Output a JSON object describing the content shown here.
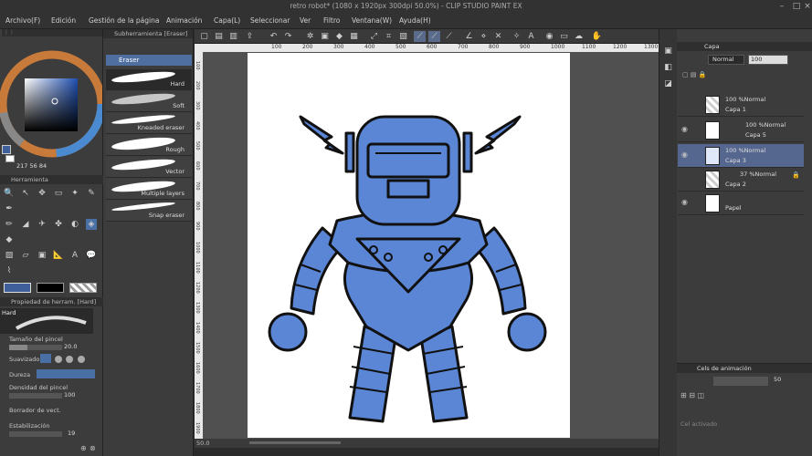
{
  "window": {
    "title": "retro robot* (1080 x 1920px 300dpi 50.0%) - CLIP STUDIO PAINT EX"
  },
  "menu": {
    "items": [
      "Archivo(F)",
      "Edición",
      "Gestión de la página",
      "Animación",
      "Capa(L)",
      "Seleccionar",
      "Ver",
      "Filtro",
      "Ventana(W)",
      "Ayuda(H)"
    ]
  },
  "color": {
    "main": "#3f5f9a",
    "values": [
      "217",
      "56",
      "84"
    ]
  },
  "subtool": {
    "panel_title": "Subherramienta [Eraser]",
    "group": "Eraser",
    "items": [
      "Hard",
      "Soft",
      "Kneaded eraser",
      "Rough",
      "Vector",
      "Multiple layers",
      "Snap eraser"
    ]
  },
  "tools": {
    "panel_title": "Herramienta"
  },
  "tool_property": {
    "panel_title": "Propiedad de herram. [Hard]",
    "preview_label": "Hard",
    "brush_size_label": "Tamaño del pincel",
    "brush_size_value": "20.0",
    "antialias_label": "Suavizado",
    "hardness_label": "Dureza",
    "density_label": "Densidad del pincel",
    "density_value": "100",
    "erase_label": "Borrador de vect.",
    "stabilization_label": "Estabilización",
    "stabilization_value": "19"
  },
  "layer_panel": {
    "tab_label": "Capa",
    "blend_mode": "Normal",
    "opacity": "100",
    "layers": [
      {
        "blend": "100 %Normal",
        "name": "Capa 1"
      },
      {
        "blend": "100 %Normal",
        "name": "Capa 5"
      },
      {
        "blend": "100 %Normal",
        "name": "Capa 3"
      },
      {
        "blend": "37 %Normal",
        "name": "Capa 2"
      },
      {
        "blend": "",
        "name": "Papel"
      }
    ]
  },
  "animation_panel": {
    "tab_label": "Cels de animación",
    "frame_value": "50",
    "status": "Cel activado"
  },
  "status": {
    "zoom": "50.0"
  },
  "ruler": {
    "ticks": [
      "100",
      "200",
      "300",
      "400",
      "500",
      "600",
      "700",
      "800",
      "900",
      "1000",
      "1100",
      "1200",
      "1300"
    ],
    "vticks": [
      "100",
      "200",
      "300",
      "400",
      "500",
      "600",
      "700",
      "800",
      "900",
      "1000",
      "1100",
      "1200",
      "1300",
      "1400",
      "1500",
      "1600",
      "1700",
      "1800",
      "1900"
    ]
  }
}
